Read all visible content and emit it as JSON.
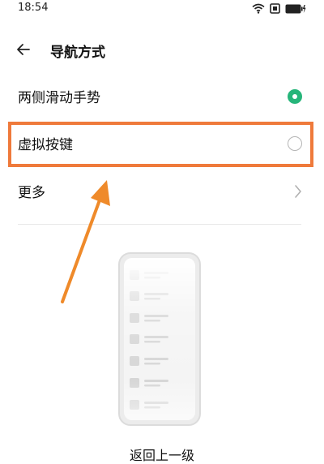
{
  "status_bar": {
    "time": "18:54",
    "icons": [
      "wifi-icon",
      "screen-icon",
      "battery-charging-icon"
    ]
  },
  "header": {
    "title": "导航方式",
    "back_icon": "arrow-left-icon"
  },
  "options": {
    "gestures": {
      "label": "两侧滑动手势",
      "selected": true
    },
    "virtual_keys": {
      "label": "虚拟按键",
      "selected": false
    },
    "more": {
      "label": "更多",
      "icon": "chevron-right-icon"
    }
  },
  "annotation": {
    "highlight_color": "#ef7a3b",
    "arrow_color": "#ef8a2a",
    "target": "virtual_keys"
  },
  "illustration": {
    "caption": "返回上一级"
  },
  "colors": {
    "accent": "#26b57a",
    "text": "#111111"
  }
}
